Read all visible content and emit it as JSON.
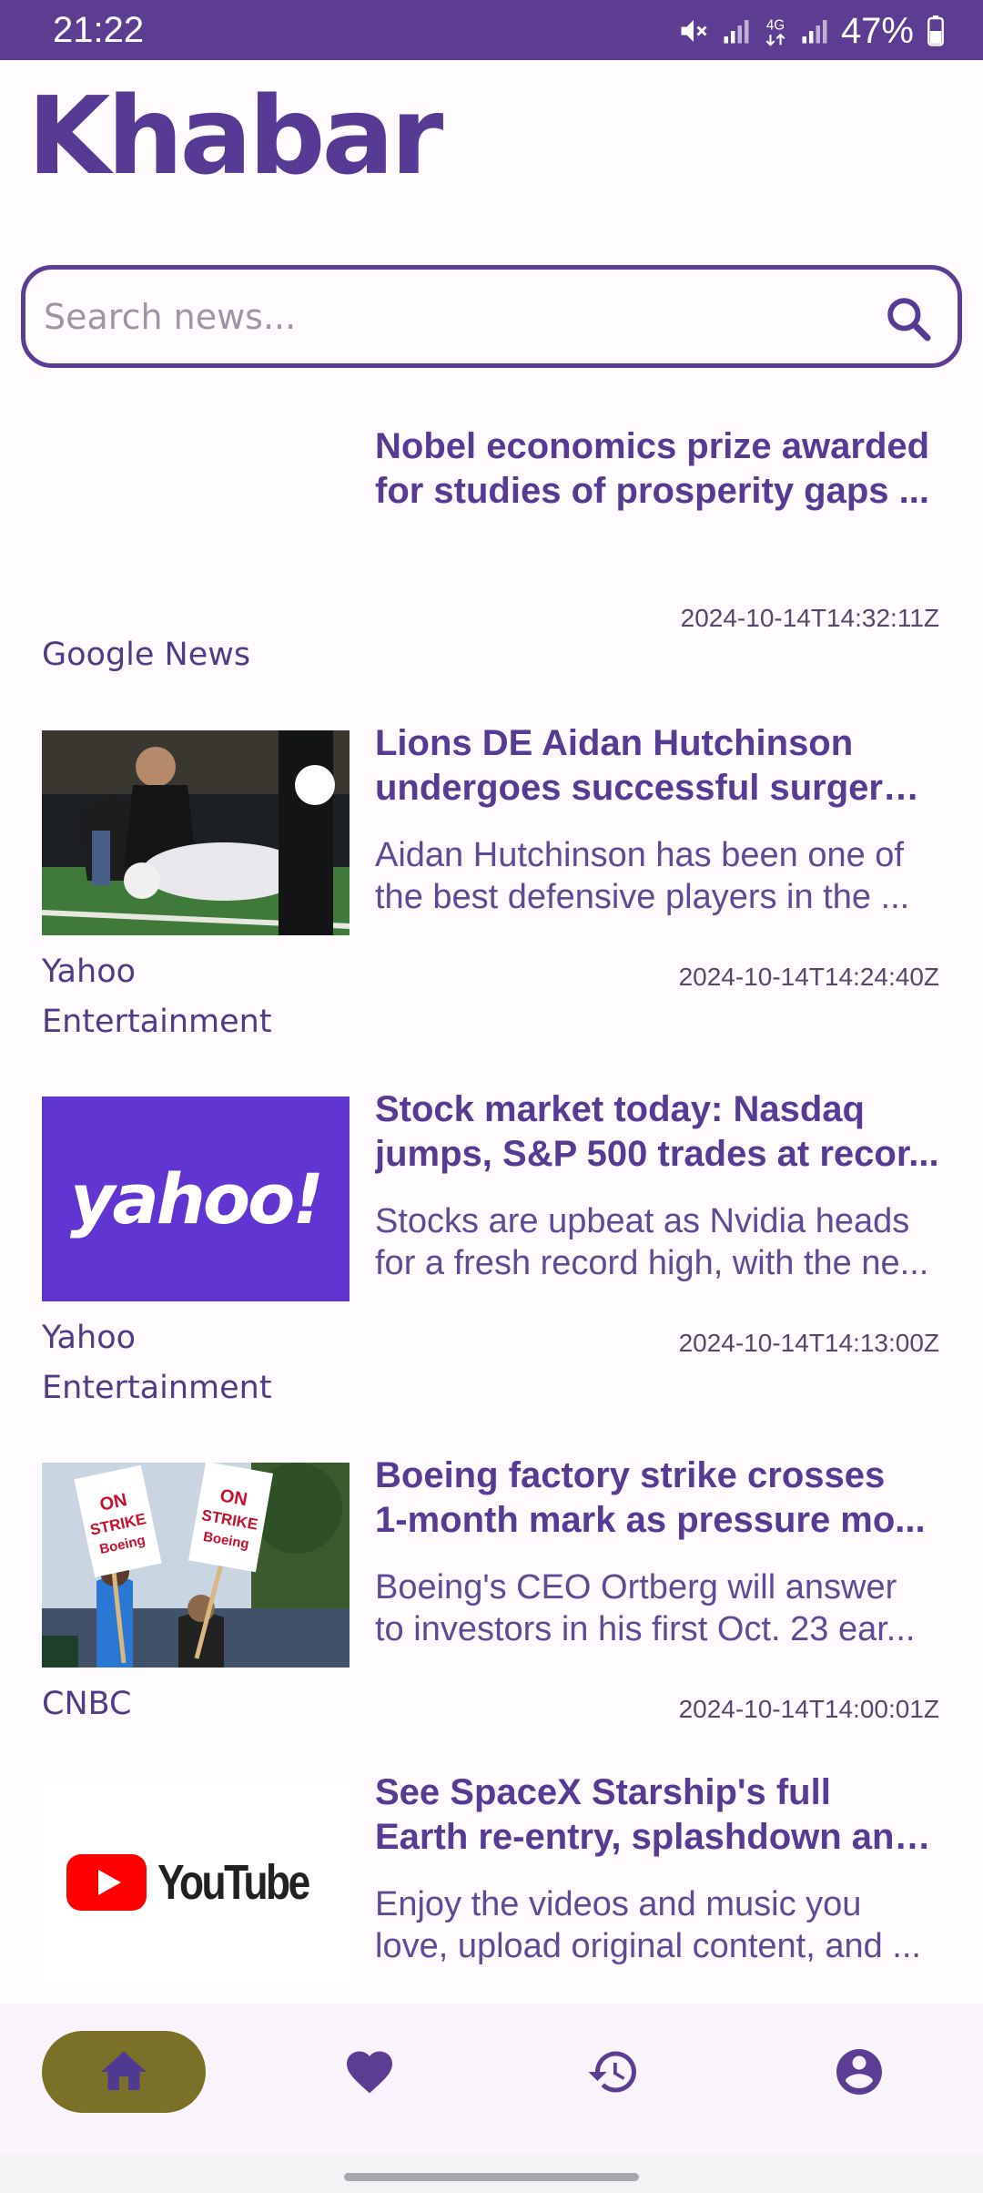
{
  "status_bar": {
    "time": "21:22",
    "battery": "47%",
    "network": "4G",
    "icons": [
      "mute-icon",
      "signal-icon",
      "4g-icon",
      "signal-icon",
      "battery-icon"
    ]
  },
  "app": {
    "title": "Khabar",
    "accent_color": "#5b3e94",
    "nav_active_color": "#7a7028"
  },
  "search": {
    "placeholder": "Search news...",
    "value": "",
    "icon": "search-icon"
  },
  "articles": [
    {
      "title_lines": [
        "Nobel economics prize awarded",
        "for studies of prosperity gaps ..."
      ],
      "description_lines": [],
      "date": "2024-10-14T14:32:11Z",
      "source_lines": [
        "Google News"
      ],
      "thumbnail": "none"
    },
    {
      "title_lines": [
        "Lions DE Aidan Hutchinson",
        "undergoes successful surgery ..."
      ],
      "description_lines": [
        "Aidan Hutchinson has been one of",
        "the best defensive players in the ..."
      ],
      "date": "2024-10-14T14:24:40Z",
      "source_lines": [
        "Yahoo",
        "Entertainment"
      ],
      "thumbnail": "football-injury-photo"
    },
    {
      "title_lines": [
        "Stock market today: Nasdaq",
        "jumps, S&P 500 trades at recor..."
      ],
      "description_lines": [
        "Stocks are upbeat as Nvidia heads",
        "for a fresh record high, with the ne..."
      ],
      "date": "2024-10-14T14:13:00Z",
      "source_lines": [
        "Yahoo",
        "Entertainment"
      ],
      "thumbnail": "yahoo-logo",
      "thumbnail_text": "yahoo!"
    },
    {
      "title_lines": [
        "Boeing factory strike crosses",
        "1-month mark as pressure mo..."
      ],
      "description_lines": [
        "Boeing's CEO Ortberg will answer",
        "to investors in his first Oct. 23 ear..."
      ],
      "date": "2024-10-14T14:00:01Z",
      "source_lines": [
        "CNBC"
      ],
      "thumbnail": "strike-protest-photo",
      "thumbnail_text": [
        "ON",
        "STRIKE",
        "Boeing"
      ]
    },
    {
      "title_lines": [
        "See SpaceX Starship's full",
        "Earth re-entry, splashdown and..."
      ],
      "description_lines": [
        "Enjoy the videos and music you",
        "love, upload original content, and ..."
      ],
      "date": "",
      "source_lines": [],
      "thumbnail": "youtube-logo",
      "thumbnail_text": "YouTube"
    }
  ],
  "bottom_nav": [
    {
      "name": "home",
      "icon": "home-icon",
      "active": true
    },
    {
      "name": "favorites",
      "icon": "heart-icon",
      "active": false
    },
    {
      "name": "history",
      "icon": "history-icon",
      "active": false
    },
    {
      "name": "profile",
      "icon": "account-icon",
      "active": false
    }
  ]
}
